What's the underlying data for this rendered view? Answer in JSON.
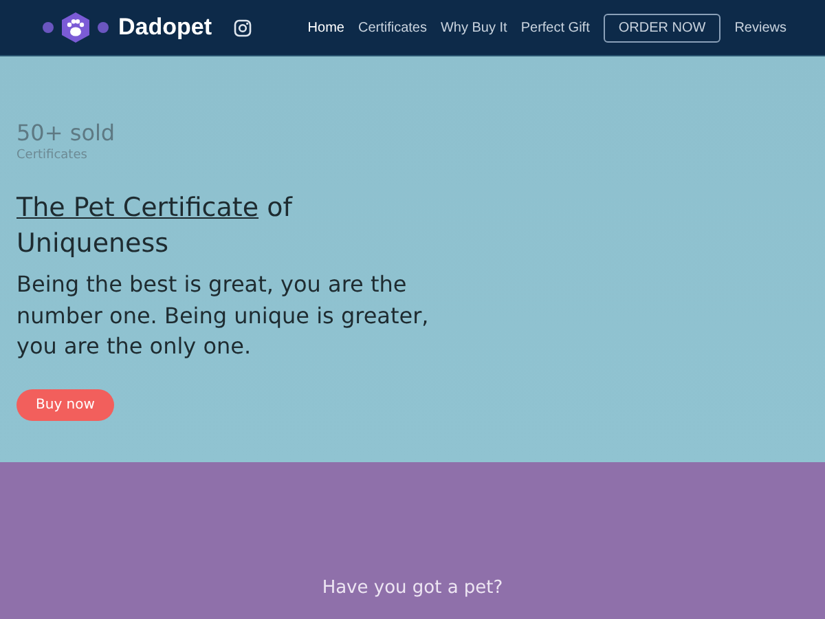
{
  "header": {
    "brand": "Dadopet",
    "nav": [
      {
        "label": "Home",
        "selected": true,
        "kind": "link"
      },
      {
        "label": "Certificates",
        "selected": false,
        "kind": "link"
      },
      {
        "label": "Why Buy It",
        "selected": false,
        "kind": "link"
      },
      {
        "label": "Perfect Gift",
        "selected": false,
        "kind": "link"
      },
      {
        "label": "ORDER NOW",
        "selected": false,
        "kind": "outlined"
      },
      {
        "label": "Reviews",
        "selected": false,
        "kind": "link"
      }
    ]
  },
  "hero": {
    "stat": "50+ sold",
    "stat_label": "Certificates",
    "title_link": "The Pet Certificate",
    "title_rest": "of Uniqueness",
    "lead": "Being the best is great, you are the number one. Being unique is greater, you are the only one.",
    "button": "Buy now"
  },
  "section": {
    "heading": "Have you got a pet?"
  }
}
